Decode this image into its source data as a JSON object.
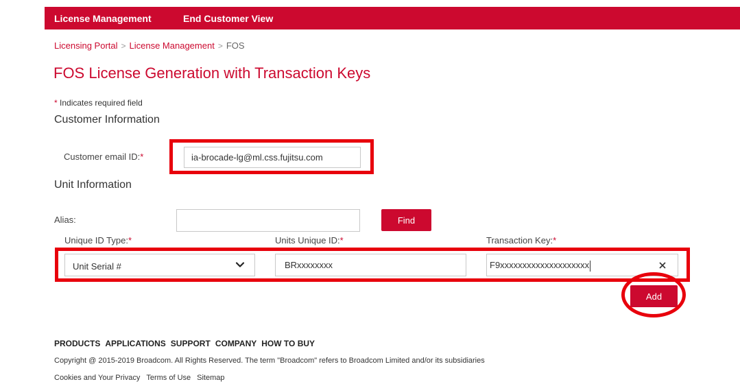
{
  "nav": {
    "items": [
      "License Management",
      "End Customer View"
    ]
  },
  "breadcrumb": {
    "items": [
      "Licensing Portal",
      "License Management",
      "FOS"
    ],
    "separator": ">"
  },
  "page": {
    "title": "FOS License Generation with Transaction Keys",
    "required_star": "*",
    "required_note": " Indicates required field"
  },
  "customer": {
    "section_title": "Customer Information",
    "email_label": "Customer email ID:",
    "email_value": "ia-brocade-lg@ml.css.fujitsu.com"
  },
  "unit": {
    "section_title": "Unit Information",
    "alias_label": "Alias:",
    "alias_value": "",
    "find_label": "Find",
    "id_type_label": "Unique ID Type:",
    "id_type_value": "Unit Serial #",
    "unique_id_label": "Units Unique ID:",
    "unique_id_value": "BRxxxxxxxx",
    "transaction_key_label": "Transaction Key:",
    "transaction_key_value": "F9xxxxxxxxxxxxxxxxxxxx",
    "add_label": "Add"
  },
  "footer": {
    "nav": [
      "PRODUCTS",
      "APPLICATIONS",
      "SUPPORT",
      "COMPANY",
      "HOW TO BUY"
    ],
    "copyright": "Copyright @ 2015-2019 Broadcom. All Rights Reserved. The term \"Broadcom\" refers to Broadcom Limited and/or its subsidiaries",
    "links": [
      "Cookies and Your Privacy",
      "Terms of Use",
      "Sitemap"
    ]
  },
  "colors": {
    "brand": "#cc092f",
    "highlight": "#e8000c"
  }
}
